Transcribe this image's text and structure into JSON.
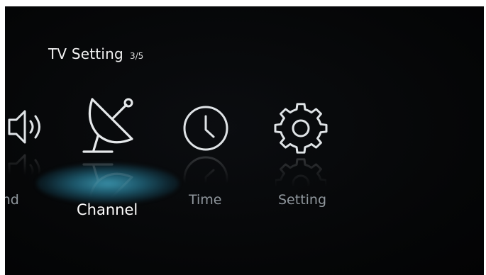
{
  "header": {
    "title": "TV Setting",
    "page": "3/5"
  },
  "menu": {
    "items": [
      {
        "label": "Sound",
        "icon": "speaker-icon",
        "selected": false
      },
      {
        "label": "Channel",
        "icon": "satellite-dish-icon",
        "selected": true
      },
      {
        "label": "Time",
        "icon": "clock-icon",
        "selected": false
      },
      {
        "label": "Setting",
        "icon": "gear-icon",
        "selected": false
      }
    ]
  },
  "colors": {
    "background": "#050607",
    "selected_label": "#ffffff",
    "label": "#8f969c",
    "focus_glow": "#3c96af"
  }
}
